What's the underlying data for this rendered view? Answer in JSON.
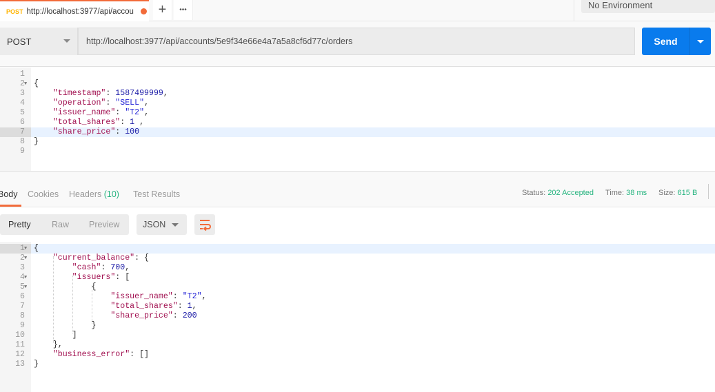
{
  "tab": {
    "method": "POST",
    "title": "http://localhost:3977/api/accou",
    "unsaved": true
  },
  "tab_actions": {
    "new_tab": "+",
    "more": "•••"
  },
  "environment": "No Environment",
  "request": {
    "method": "POST",
    "url": "http://localhost:3977/api/accounts/5e9f34e66e4a7a5a8cf6d77c/orders",
    "send_label": "Send",
    "body_lines": [
      [],
      [
        [
          "pun",
          "{"
        ]
      ],
      [
        [
          "pun",
          "    "
        ],
        [
          "key",
          "\"timestamp\""
        ],
        [
          "pun",
          ": "
        ],
        [
          "num-v",
          "1587499999"
        ],
        [
          "pun",
          ","
        ]
      ],
      [
        [
          "pun",
          "    "
        ],
        [
          "key",
          "\"operation\""
        ],
        [
          "pun",
          ": "
        ],
        [
          "str",
          "\"SELL\""
        ],
        [
          "pun",
          ","
        ]
      ],
      [
        [
          "pun",
          "    "
        ],
        [
          "key",
          "\"issuer_name\""
        ],
        [
          "pun",
          ": "
        ],
        [
          "str",
          "\"T2\""
        ],
        [
          "pun",
          ","
        ]
      ],
      [
        [
          "pun",
          "    "
        ],
        [
          "key",
          "\"total_shares\""
        ],
        [
          "pun",
          ": "
        ],
        [
          "num-v",
          "1"
        ],
        [
          "pun",
          " ,"
        ]
      ],
      [
        [
          "pun",
          "    "
        ],
        [
          "key",
          "\"share_price\""
        ],
        [
          "pun",
          ": "
        ],
        [
          "num-v",
          "100"
        ]
      ],
      [
        [
          "pun",
          "}"
        ]
      ],
      []
    ],
    "folds": [
      2
    ],
    "highlight": 7
  },
  "response": {
    "tabs": [
      "Body",
      "Cookies",
      "Headers",
      "Test Results"
    ],
    "headers_count": "(10)",
    "status_label": "Status:",
    "status": "202 Accepted",
    "time_label": "Time:",
    "time": "38 ms",
    "size_label": "Size:",
    "size": "615 B",
    "views": [
      "Pretty",
      "Raw",
      "Preview"
    ],
    "format": "JSON",
    "body_lines": [
      [
        [
          "pun",
          "{"
        ]
      ],
      [
        [
          "pun",
          "    "
        ],
        [
          "key",
          "\"current_balance\""
        ],
        [
          "pun",
          ": {"
        ]
      ],
      [
        [
          "pun",
          "        "
        ],
        [
          "key",
          "\"cash\""
        ],
        [
          "pun",
          ": "
        ],
        [
          "num-v",
          "700"
        ],
        [
          "pun",
          ","
        ]
      ],
      [
        [
          "pun",
          "        "
        ],
        [
          "key",
          "\"issuers\""
        ],
        [
          "pun",
          ": ["
        ]
      ],
      [
        [
          "pun",
          "            {"
        ]
      ],
      [
        [
          "pun",
          "                "
        ],
        [
          "key",
          "\"issuer_name\""
        ],
        [
          "pun",
          ": "
        ],
        [
          "str",
          "\"T2\""
        ],
        [
          "pun",
          ","
        ]
      ],
      [
        [
          "pun",
          "                "
        ],
        [
          "key",
          "\"total_shares\""
        ],
        [
          "pun",
          ": "
        ],
        [
          "num-v",
          "1"
        ],
        [
          "pun",
          ","
        ]
      ],
      [
        [
          "pun",
          "                "
        ],
        [
          "key",
          "\"share_price\""
        ],
        [
          "pun",
          ": "
        ],
        [
          "num-v",
          "200"
        ]
      ],
      [
        [
          "pun",
          "            }"
        ]
      ],
      [
        [
          "pun",
          "        ]"
        ]
      ],
      [
        [
          "pun",
          "    },"
        ]
      ],
      [
        [
          "pun",
          "    "
        ],
        [
          "key",
          "\"business_error\""
        ],
        [
          "pun",
          ": []"
        ]
      ],
      [
        [
          "pun",
          "}"
        ]
      ]
    ],
    "folds": [
      1,
      2,
      4,
      5
    ],
    "highlight": 1
  },
  "colors": {
    "accent": "#f26b3a",
    "send": "#097bed",
    "status": "#26b47f"
  }
}
